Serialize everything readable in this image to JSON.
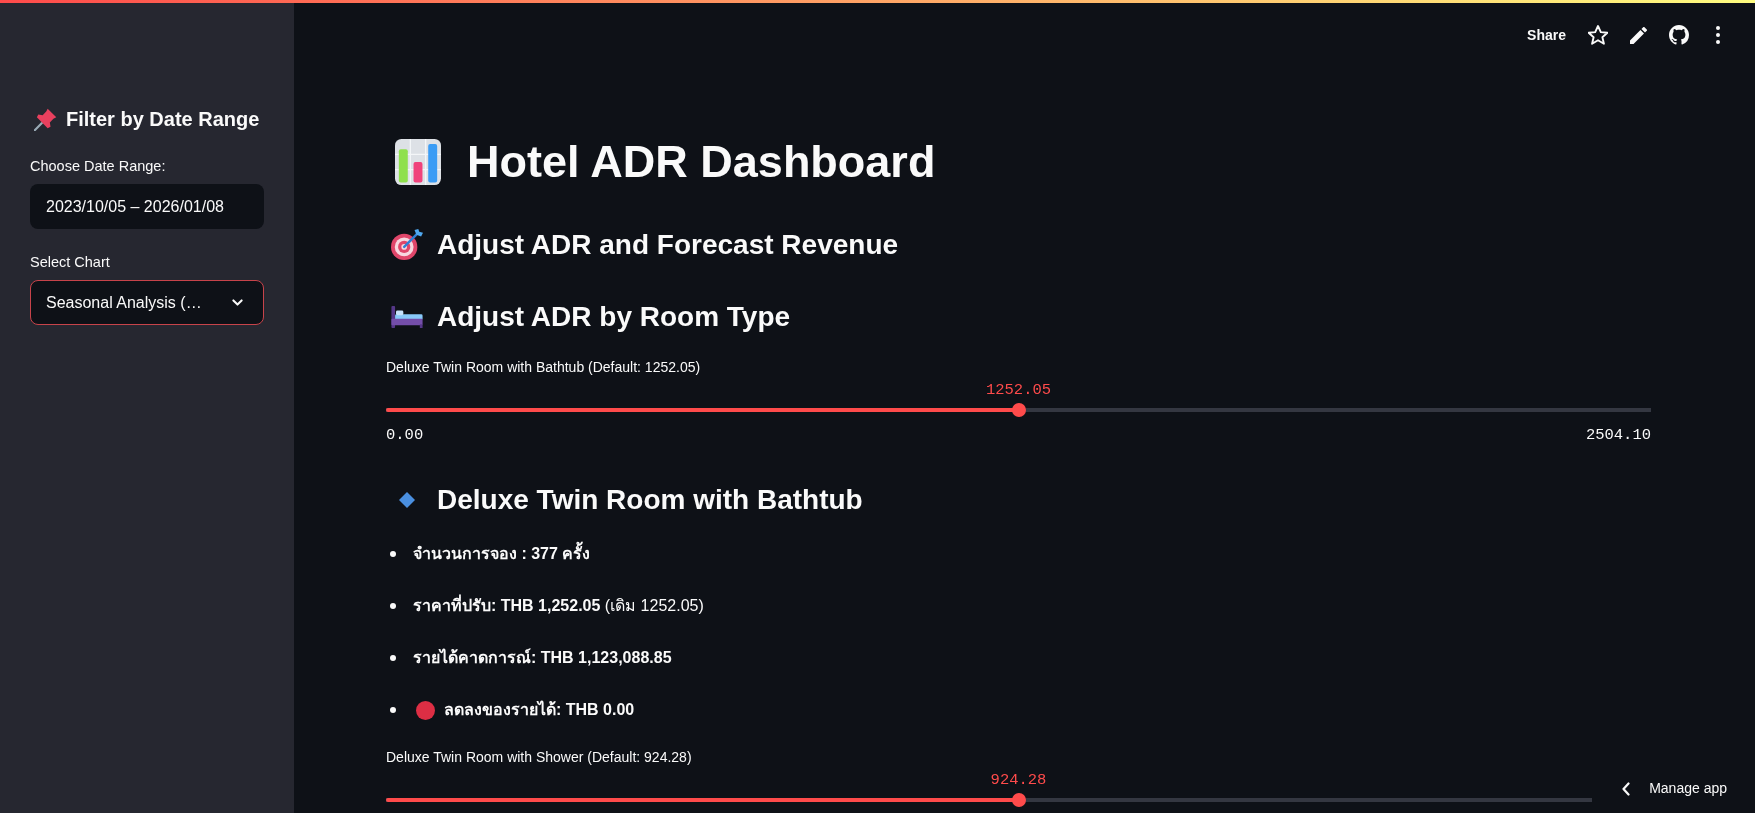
{
  "toolbar": {
    "share": "Share"
  },
  "sidebar": {
    "heading": "Filter by Date Range",
    "date_range": {
      "label": "Choose Date Range:",
      "value": "2023/10/05 – 2026/01/08"
    },
    "chart_select": {
      "label": "Select Chart",
      "value": "Seasonal Analysis (…",
      "focused": true
    }
  },
  "main": {
    "title": "Hotel ADR Dashboard",
    "subheader": "Adjust ADR and Forecast Revenue",
    "section_heading": "Adjust ADR by Room Type",
    "rooms": [
      {
        "slider": {
          "label": "Deluxe Twin Room with Bathtub (Default: 1252.05)",
          "reading": "1252.05",
          "level": 0.5,
          "min": "0.00",
          "max": "2504.10"
        },
        "heading": "Deluxe Twin Room with Bathtub",
        "facts": [
          {
            "kind": "plain",
            "label": "จำนวนการจอง : 377 ครั้ง"
          },
          {
            "kind": "plain",
            "label": "ราคาที่ปรับ: THB 1,252.05",
            "note": "(เดิม 1252.05)"
          },
          {
            "kind": "plain",
            "label": "รายได้คาดการณ์: THB 1,123,088.85"
          },
          {
            "kind": "status",
            "color": "#dd2e44",
            "label": "ลดลงของรายได้: THB 0.00"
          }
        ]
      },
      {
        "slider": {
          "label": "Deluxe Twin Room with Shower (Default: 924.28)",
          "reading": "924.28",
          "level": 0.5
        }
      }
    ]
  },
  "manage_app": {
    "label": "Manage app"
  }
}
